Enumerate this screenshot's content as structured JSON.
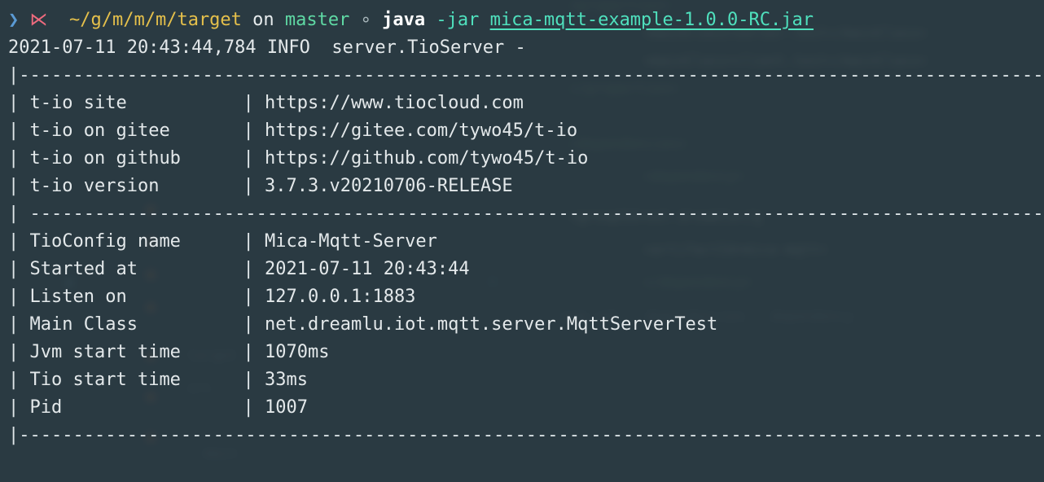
{
  "terminal": {
    "background_color": "#2e3d45",
    "foreground_color": "#e3e8ea",
    "prompt": {
      "status_icon": "triangle-right-icon",
      "vcs_icon": "git-branch-arrow-icon",
      "path": "~/g/m/m/m/target",
      "on_keyword": "on",
      "branch": "master",
      "branch_state_icon": "circle-outline-icon",
      "command_name": "java",
      "command_flag": "-jar",
      "command_arg": "mica-mqtt-example-1.0.0-RC.jar",
      "colors": {
        "path": "#e5c04b",
        "branch": "#5fd9a4",
        "command": "#ffffff",
        "flag": "#4fe0bd",
        "arg": "#4fe0bd",
        "status_icon": "#5b9bd5",
        "vcs_icon": "#ef6b7e"
      }
    },
    "log_line": {
      "timestamp": "2021-07-11 20:43:44,784",
      "level": "INFO",
      "logger": "server.TioServer",
      "dash": "-",
      "full": "2021-07-11 20:43:44,784 INFO  server.TioServer -"
    },
    "banner": {
      "top_border": "|----------------------------------------------------------------------------------------------------|",
      "mid_border": "| ---------------------------------------------------------------------------------------------------",
      "bottom_border": "|----------------------------------------------------------------------------------------------------|",
      "pipe": "|",
      "group_one": [
        {
          "key": "t-io site",
          "value": "https://www.tiocloud.com"
        },
        {
          "key": "t-io on gitee",
          "value": "https://gitee.com/tywo45/t-io"
        },
        {
          "key": "t-io on github",
          "value": "https://github.com/tywo45/t-io"
        },
        {
          "key": "t-io version",
          "value": "3.7.3.v20210706-RELEASE"
        }
      ],
      "group_two": [
        {
          "key": "TioConfig name",
          "value": "Mica-Mqtt-Server"
        },
        {
          "key": "Started at",
          "value": "2021-07-11 20:43:44"
        },
        {
          "key": "Listen on",
          "value": "127.0.0.1:1883"
        },
        {
          "key": "Main Class",
          "value": "net.dreamlu.iot.mqtt.server.MqttServerTest"
        },
        {
          "key": "Jvm start time",
          "value": "1070ms"
        },
        {
          "key": "Tio start time",
          "value": "33ms"
        },
        {
          "key": "Pid",
          "value": "1007"
        }
      ]
    },
    "background_ghost": {
      "note": "blurred editor window behind translucent terminal",
      "lines": [
        "<mainClass>server.test</mainClass>",
        "<mainClass>client.test</mainClass>",
        "</properties>",
        "<dependencies>",
        "<dependency>",
        "<groupId>net.dreamlu</groupId>",
        "<artifactId>mica-mqtt</artifactId>",
        "</dependency>",
        "</dependencies>",
        "pom.xml  dependencies  dependency"
      ]
    }
  }
}
